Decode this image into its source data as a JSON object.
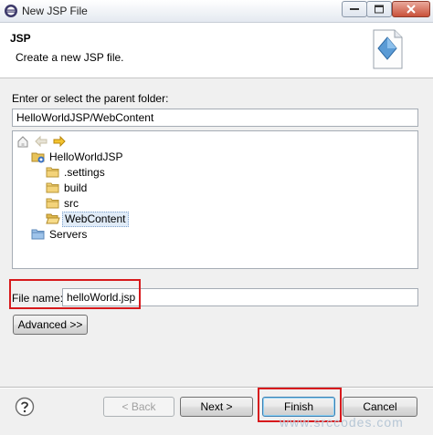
{
  "window": {
    "title": "New JSP File"
  },
  "header": {
    "title": "JSP",
    "description": "Create a new JSP file."
  },
  "parent_folder": {
    "label": "Enter or select the parent folder:",
    "value": "HelloWorldJSP/WebContent"
  },
  "tree": {
    "items": [
      {
        "label": "HelloWorldJSP",
        "icon": "project-icon"
      },
      {
        "label": ".settings",
        "icon": "folder-icon"
      },
      {
        "label": "build",
        "icon": "folder-icon"
      },
      {
        "label": "src",
        "icon": "folder-icon"
      },
      {
        "label": "WebContent",
        "icon": "folder-open-icon",
        "selected": true
      },
      {
        "label": "Servers",
        "icon": "folder-icon"
      }
    ]
  },
  "file_name": {
    "label": "File name:",
    "value": "helloWorld.jsp"
  },
  "buttons": {
    "advanced": "Advanced >>",
    "back": "< Back",
    "next": "Next >",
    "finish": "Finish",
    "cancel": "Cancel"
  },
  "watermark": "www.srccodes.com",
  "colors": {
    "highlight": "#d7191c",
    "selection": "#e0ebf7"
  }
}
